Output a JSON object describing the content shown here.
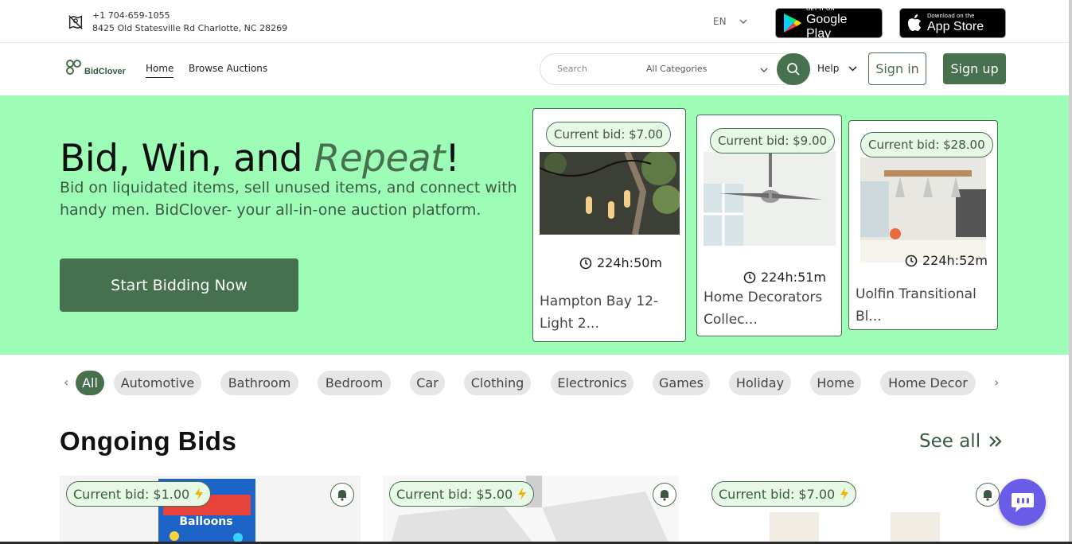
{
  "topbar": {
    "phone": "+1 704-659-1055",
    "address": "8425 Old Statesville Rd Charlotte, NC 28269",
    "language": "EN",
    "google_play": {
      "small": "GET IT ON",
      "big": "Google Play"
    },
    "app_store": {
      "small": "Download on the",
      "big": "App Store"
    }
  },
  "nav": {
    "logo_text": "BidClover",
    "links": [
      "Home",
      "Browse Auctions"
    ],
    "search_placeholder": "Search",
    "category_select": "All Categories",
    "help": "Help",
    "signin": "Sign in",
    "signup": "Sign up"
  },
  "hero": {
    "title_pre": "Bid, Win, and ",
    "title_em": "Repeat",
    "title_post": "!",
    "subtitle": "Bid on liquidated items, sell unused items, and connect with handy men. BidClover- your all-in-one auction platform.",
    "cta": "Start Bidding Now",
    "cards": [
      {
        "bid": "Current bid: $7.00",
        "timer": "224h:50m",
        "name": "Hampton Bay 12-Light 2..."
      },
      {
        "bid": "Current bid: $9.00",
        "timer": "224h:51m",
        "name": "Home Decorators Collec..."
      },
      {
        "bid": "Current bid: $28.00",
        "timer": "224h:52m",
        "name": "Uolfin Transitional Bl..."
      }
    ]
  },
  "categories": [
    "All",
    "Automotive",
    "Bathroom",
    "Bedroom",
    "Car",
    "Clothing",
    "Electronics",
    "Games",
    "Holiday",
    "Home",
    "Home Decor"
  ],
  "ongoing": {
    "title": "Ongoing Bids",
    "see_all": "See all",
    "bids": [
      "Current bid: $1.00",
      "Current bid: $5.00",
      "Current bid: $7.00"
    ],
    "balloons_text": "Balloons"
  },
  "colors": {
    "brand": "#47704f",
    "hero_bg": "#9dfdb6",
    "chat": "#6a5ce8",
    "bolt": "#f0b400"
  }
}
